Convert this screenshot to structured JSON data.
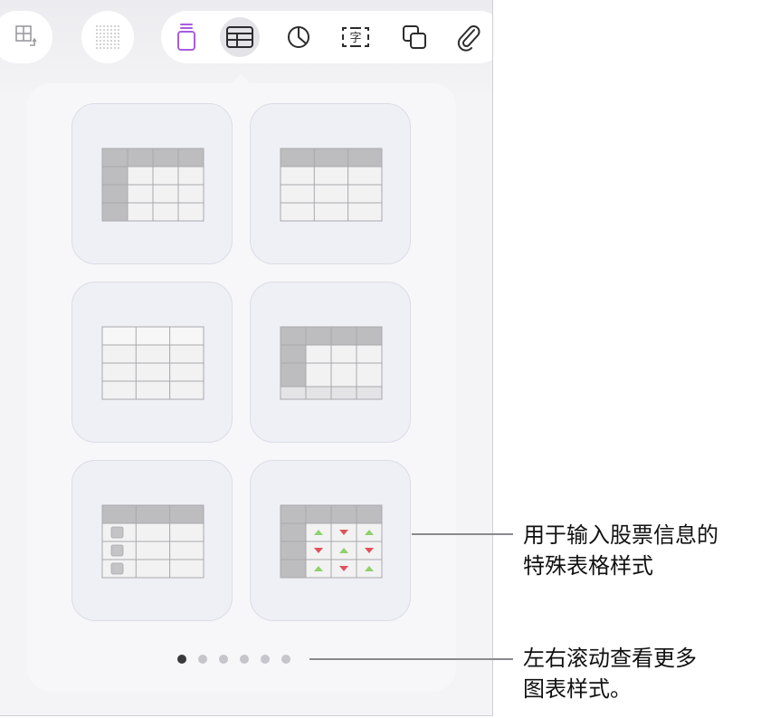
{
  "toolbar": {
    "items": [
      {
        "name": "table-options-icon",
        "selected": false
      },
      {
        "name": "grid-dots-icon",
        "selected": false
      },
      {
        "name": "text-box-icon",
        "selected": false
      },
      {
        "name": "table-icon",
        "selected": true
      },
      {
        "name": "chart-icon",
        "selected": false
      },
      {
        "name": "text-field-icon",
        "selected": false
      },
      {
        "name": "shape-icon",
        "selected": false
      },
      {
        "name": "attachment-icon",
        "selected": false
      }
    ],
    "text_field_glyph": "字",
    "accent_color": "#a95ce0"
  },
  "table_styles": [
    {
      "style": "header-row-and-column"
    },
    {
      "style": "header-row"
    },
    {
      "style": "plain"
    },
    {
      "style": "header-row-column-footer"
    },
    {
      "style": "checklist"
    },
    {
      "style": "stocks"
    }
  ],
  "pagination": {
    "count": 6,
    "active_index": 0
  },
  "annotations": {
    "stocks": {
      "line1": "用于输入股票信息的",
      "line2": "特殊表格样式"
    },
    "scroll": {
      "line1": "左右滚动查看更多",
      "line2": "图表样式。"
    }
  },
  "colors": {
    "up": "#8fd16b",
    "down": "#e0525a",
    "header": "#bdbdbf",
    "cell": "#f2f2f3"
  }
}
